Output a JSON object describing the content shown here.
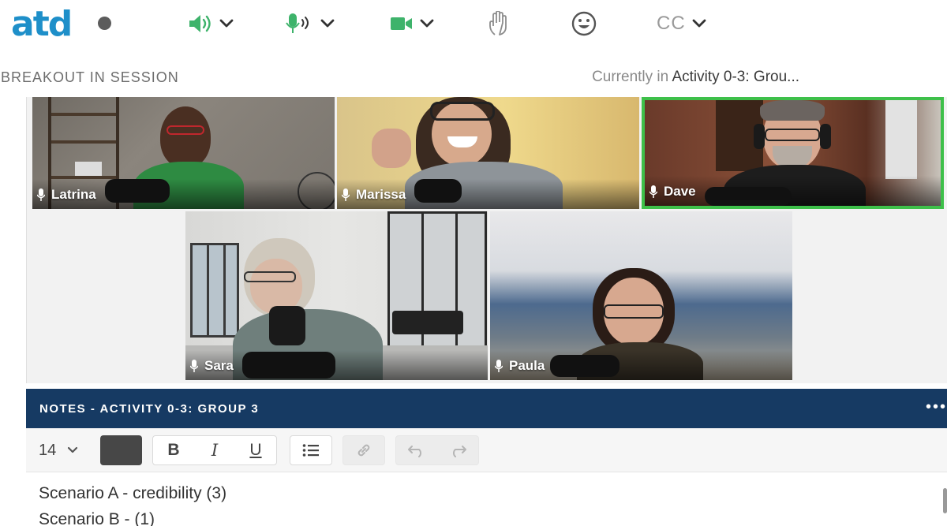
{
  "brand": {
    "logo_text": "atd",
    "logo_color": "#1e8fc9"
  },
  "toolbar": {
    "status_icon": "status-dot",
    "speaker": {
      "icon": "speaker-icon",
      "color": "#3eb36b"
    },
    "microphone": {
      "icon": "microphone-icon",
      "color": "#3eb36b"
    },
    "camera": {
      "icon": "video-camera-icon",
      "color": "#3eb36b"
    },
    "raise_hand": {
      "icon": "raise-hand-icon"
    },
    "emoji": {
      "icon": "smiley-icon"
    },
    "captions": {
      "label": "CC"
    }
  },
  "session": {
    "status": "BREAKOUT IN SESSION",
    "currently_prefix": "Currently in",
    "activity": "Activity 0-3: Grou..."
  },
  "participants": [
    {
      "name": "Latrina",
      "active_speaker": false
    },
    {
      "name": "Marissa",
      "active_speaker": false
    },
    {
      "name": "Dave",
      "active_speaker": true
    },
    {
      "name": "Sara",
      "active_speaker": false
    },
    {
      "name": "Paula",
      "active_speaker": false
    }
  ],
  "notes": {
    "title": "NOTES  - ACTIVITY 0-3: GROUP 3",
    "more": "•••",
    "font_size": "14",
    "text_color": "#474747",
    "format": {
      "bold": "B",
      "italic": "I",
      "underline": "U"
    },
    "lines": [
      "Scenario A - credibility (3)",
      "Scenario B - (1)"
    ]
  },
  "colors": {
    "header_bg": "#163a63",
    "active_speaker_border": "#3ec04a"
  }
}
